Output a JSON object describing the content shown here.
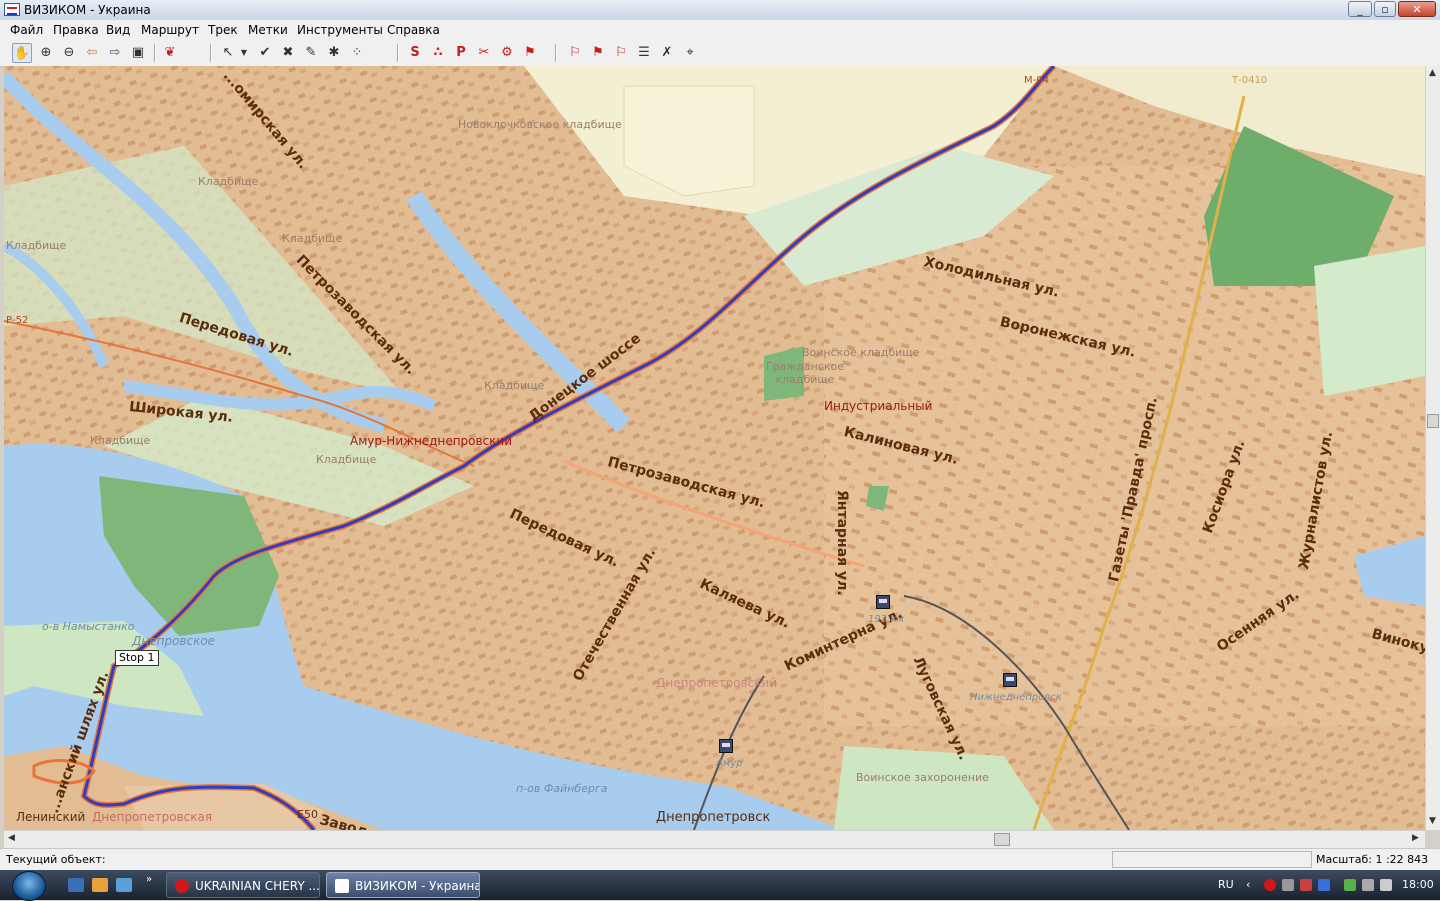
{
  "window": {
    "title": "ВИЗИКОМ - Украина"
  },
  "menu": [
    "Файл",
    "Правка",
    "Вид",
    "Маршрут",
    "Трек",
    "Метки",
    "Инструменты",
    "Справка"
  ],
  "toolbar": {
    "icons": [
      "hand-icon",
      "zoom-in-icon",
      "zoom-out-icon",
      "back-arrow-icon",
      "forward-arrow-icon",
      "fit-extent-icon",
      "find-object-icon",
      "select-cursor-icon",
      "dropdown-arrow-icon",
      "track-check-icon",
      "track-remove-icon",
      "track-edit-icon",
      "track-star-icon",
      "track-points-icon",
      "poi-s-icon",
      "poi-dots-icon",
      "parking-p-icon",
      "route-clear-icon",
      "route-settings-icon",
      "route-build-icon",
      "flag-start-icon",
      "flag-end-icon",
      "flag-via-icon",
      "route-list-icon",
      "route-delete-icon",
      "route-options-icon"
    ]
  },
  "map": {
    "roads": {
      "m04": "М-04",
      "p52": "Р-52",
      "t0410": "Т-0410",
      "e50": "Е50"
    },
    "streets": {
      "zhitomirskaya": "...омирская ул.",
      "petrozavodskaya_nw": "Петрозаводская ул.",
      "peredovaya_w": "Передовая ул.",
      "shirokaya": "Широкая ул.",
      "donetskoe": "Донецкое шоссе",
      "petrozavodskaya_c": "Петрозаводская ул.",
      "peredovaya_c": "Передовая ул.",
      "otechestvennaya": "Отечественная ул.",
      "kalyaeva": "Каляева ул.",
      "kominterna": "Коминтерна ул.",
      "yantarnaya": "Янтарная ул.",
      "kalinovaya": "Калиновая ул.",
      "holodilnaya": "Холодильная ул.",
      "voronezhskaya": "Воронежская ул.",
      "lugovskaya": "Луговская ул.",
      "pravda": "Газеты 'Правда' просп.",
      "kosmora": "Косиора ул.",
      "zhurnalistov": "Журналистов ул.",
      "osennyaya": "Осенняя ул.",
      "vinok": "Виноку...",
      "shlyah": "...анский шлях ул.",
      "zavodskaya": "Заводс..."
    },
    "places": {
      "amur": "Амур-Нижнеднепровский",
      "industrialny": "Индустриальный",
      "leninsky": "Ленинский",
      "dnepropetrovsky": "Днепропетровский",
      "dnepropetrovskaya": "Днепропетровская",
      "dnepropetrovsk_station": "Днепропетровск",
      "nizhnedneprovsk": "Нижнеднепровск",
      "amur_station": "Амур",
      "km193": "193 км"
    },
    "cemeteries": {
      "novokliuchovskoe": "Новоклочковское кладбище",
      "c1": "Кладбище",
      "c2": "Кладбище",
      "c3": "Кладбище",
      "c4": "Кладбище",
      "c5": "Кладбище",
      "c6": "Кладбище",
      "voinskoe": "Воинское кладбище",
      "grazhdanskoe": "Гражданское кладбище",
      "zahoronenie": "Воинское захоронение"
    },
    "water": {
      "namystanko": "о-в Намыстанко",
      "dneprovskoe": "Днепровское",
      "faynberga": "п-ов Файнберга"
    },
    "stop_label": "Stop 1"
  },
  "status": {
    "current_object_label": "Текущий объект:",
    "scale": "Масштаб: 1 :22 843"
  },
  "taskbar": {
    "tasks": [
      {
        "label": "UKRAINIAN CHERY ...",
        "active": false
      },
      {
        "label": "ВИЗИКОМ - Украина",
        "active": true
      }
    ],
    "lang": "RU",
    "clock": "18:00"
  },
  "colors": {
    "land": "#e8c8a4",
    "water": "#a7ccee",
    "forest": "#7fb77a",
    "park": "#cfe6c3",
    "route": "#2c3fbf",
    "road": "#e8743a"
  }
}
